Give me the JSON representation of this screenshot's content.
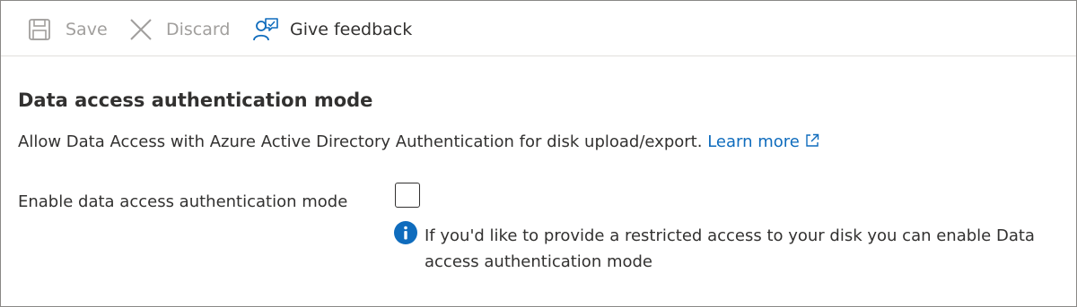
{
  "toolbar": {
    "save_label": "Save",
    "discard_label": "Discard",
    "feedback_label": "Give feedback",
    "icons": {
      "save": "save-icon",
      "discard": "close-icon",
      "feedback": "feedback-icon"
    }
  },
  "section": {
    "title": "Data access authentication mode",
    "description": "Allow Data Access with Azure Active Directory Authentication for disk upload/export.",
    "learn_more": "Learn more",
    "link_icon": "external-link-icon"
  },
  "field": {
    "label": "Enable data access authentication mode",
    "checked": false,
    "info_text": "If you'd like to provide a restricted access to your disk you can enable Data access authentication mode",
    "info_icon": "info-icon"
  },
  "colors": {
    "accent": "#0f6cbd",
    "text": "#323130",
    "disabled": "#a19f9d",
    "border": "#8a8886"
  }
}
